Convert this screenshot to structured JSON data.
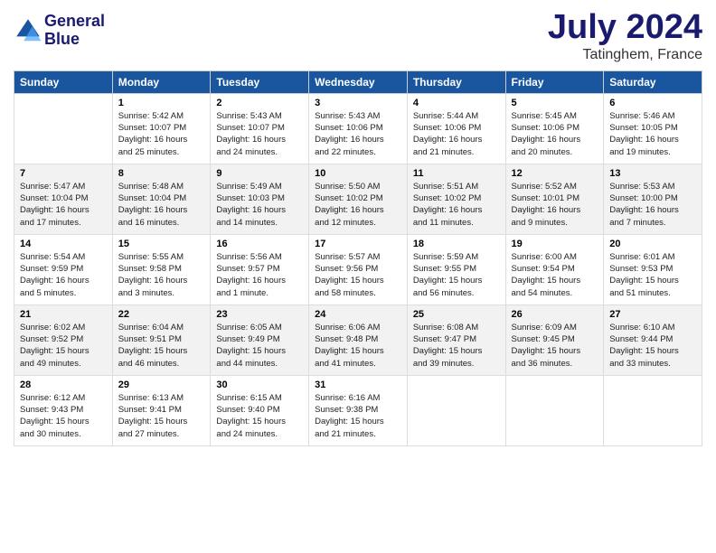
{
  "header": {
    "logo_line1": "General",
    "logo_line2": "Blue",
    "month_year": "July 2024",
    "location": "Tatinghem, France"
  },
  "days_of_week": [
    "Sunday",
    "Monday",
    "Tuesday",
    "Wednesday",
    "Thursday",
    "Friday",
    "Saturday"
  ],
  "weeks": [
    [
      {
        "day": "",
        "info": ""
      },
      {
        "day": "1",
        "info": "Sunrise: 5:42 AM\nSunset: 10:07 PM\nDaylight: 16 hours\nand 25 minutes."
      },
      {
        "day": "2",
        "info": "Sunrise: 5:43 AM\nSunset: 10:07 PM\nDaylight: 16 hours\nand 24 minutes."
      },
      {
        "day": "3",
        "info": "Sunrise: 5:43 AM\nSunset: 10:06 PM\nDaylight: 16 hours\nand 22 minutes."
      },
      {
        "day": "4",
        "info": "Sunrise: 5:44 AM\nSunset: 10:06 PM\nDaylight: 16 hours\nand 21 minutes."
      },
      {
        "day": "5",
        "info": "Sunrise: 5:45 AM\nSunset: 10:06 PM\nDaylight: 16 hours\nand 20 minutes."
      },
      {
        "day": "6",
        "info": "Sunrise: 5:46 AM\nSunset: 10:05 PM\nDaylight: 16 hours\nand 19 minutes."
      }
    ],
    [
      {
        "day": "7",
        "info": "Sunrise: 5:47 AM\nSunset: 10:04 PM\nDaylight: 16 hours\nand 17 minutes."
      },
      {
        "day": "8",
        "info": "Sunrise: 5:48 AM\nSunset: 10:04 PM\nDaylight: 16 hours\nand 16 minutes."
      },
      {
        "day": "9",
        "info": "Sunrise: 5:49 AM\nSunset: 10:03 PM\nDaylight: 16 hours\nand 14 minutes."
      },
      {
        "day": "10",
        "info": "Sunrise: 5:50 AM\nSunset: 10:02 PM\nDaylight: 16 hours\nand 12 minutes."
      },
      {
        "day": "11",
        "info": "Sunrise: 5:51 AM\nSunset: 10:02 PM\nDaylight: 16 hours\nand 11 minutes."
      },
      {
        "day": "12",
        "info": "Sunrise: 5:52 AM\nSunset: 10:01 PM\nDaylight: 16 hours\nand 9 minutes."
      },
      {
        "day": "13",
        "info": "Sunrise: 5:53 AM\nSunset: 10:00 PM\nDaylight: 16 hours\nand 7 minutes."
      }
    ],
    [
      {
        "day": "14",
        "info": "Sunrise: 5:54 AM\nSunset: 9:59 PM\nDaylight: 16 hours\nand 5 minutes."
      },
      {
        "day": "15",
        "info": "Sunrise: 5:55 AM\nSunset: 9:58 PM\nDaylight: 16 hours\nand 3 minutes."
      },
      {
        "day": "16",
        "info": "Sunrise: 5:56 AM\nSunset: 9:57 PM\nDaylight: 16 hours\nand 1 minute."
      },
      {
        "day": "17",
        "info": "Sunrise: 5:57 AM\nSunset: 9:56 PM\nDaylight: 15 hours\nand 58 minutes."
      },
      {
        "day": "18",
        "info": "Sunrise: 5:59 AM\nSunset: 9:55 PM\nDaylight: 15 hours\nand 56 minutes."
      },
      {
        "day": "19",
        "info": "Sunrise: 6:00 AM\nSunset: 9:54 PM\nDaylight: 15 hours\nand 54 minutes."
      },
      {
        "day": "20",
        "info": "Sunrise: 6:01 AM\nSunset: 9:53 PM\nDaylight: 15 hours\nand 51 minutes."
      }
    ],
    [
      {
        "day": "21",
        "info": "Sunrise: 6:02 AM\nSunset: 9:52 PM\nDaylight: 15 hours\nand 49 minutes."
      },
      {
        "day": "22",
        "info": "Sunrise: 6:04 AM\nSunset: 9:51 PM\nDaylight: 15 hours\nand 46 minutes."
      },
      {
        "day": "23",
        "info": "Sunrise: 6:05 AM\nSunset: 9:49 PM\nDaylight: 15 hours\nand 44 minutes."
      },
      {
        "day": "24",
        "info": "Sunrise: 6:06 AM\nSunset: 9:48 PM\nDaylight: 15 hours\nand 41 minutes."
      },
      {
        "day": "25",
        "info": "Sunrise: 6:08 AM\nSunset: 9:47 PM\nDaylight: 15 hours\nand 39 minutes."
      },
      {
        "day": "26",
        "info": "Sunrise: 6:09 AM\nSunset: 9:45 PM\nDaylight: 15 hours\nand 36 minutes."
      },
      {
        "day": "27",
        "info": "Sunrise: 6:10 AM\nSunset: 9:44 PM\nDaylight: 15 hours\nand 33 minutes."
      }
    ],
    [
      {
        "day": "28",
        "info": "Sunrise: 6:12 AM\nSunset: 9:43 PM\nDaylight: 15 hours\nand 30 minutes."
      },
      {
        "day": "29",
        "info": "Sunrise: 6:13 AM\nSunset: 9:41 PM\nDaylight: 15 hours\nand 27 minutes."
      },
      {
        "day": "30",
        "info": "Sunrise: 6:15 AM\nSunset: 9:40 PM\nDaylight: 15 hours\nand 24 minutes."
      },
      {
        "day": "31",
        "info": "Sunrise: 6:16 AM\nSunset: 9:38 PM\nDaylight: 15 hours\nand 21 minutes."
      },
      {
        "day": "",
        "info": ""
      },
      {
        "day": "",
        "info": ""
      },
      {
        "day": "",
        "info": ""
      }
    ]
  ]
}
